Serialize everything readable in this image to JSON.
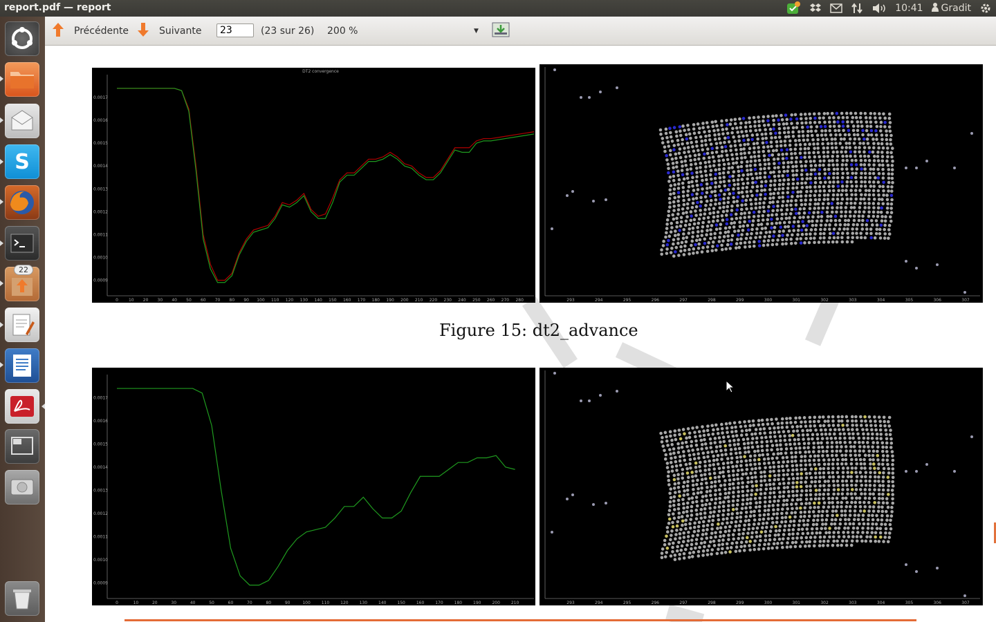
{
  "window": {
    "title": "report.pdf — report"
  },
  "panel": {
    "clock": "10:41",
    "user": "Gradit"
  },
  "toolbar": {
    "prev_label": "Précédente",
    "next_label": "Suivante",
    "page_value": "23",
    "page_count": "(23 sur 26)",
    "zoom": "200 %"
  },
  "launcher": {
    "badge_count": "22"
  },
  "document": {
    "caption": "Figure 15: dt2_advance",
    "plot_title": "DT2 convergence"
  },
  "chart_data": [
    {
      "type": "line",
      "title": "DT2 convergence",
      "x_ticks": [
        "0",
        "10",
        "20",
        "30",
        "40",
        "50",
        "60",
        "70",
        "80",
        "90",
        "100",
        "110",
        "120",
        "130",
        "140",
        "150",
        "160",
        "170",
        "180",
        "190",
        "200",
        "210",
        "220",
        "230",
        "240",
        "250",
        "260",
        "270",
        "280"
      ],
      "y_ticks": [
        "0.0009",
        "0.0010",
        "0.0011",
        "0.0012",
        "0.0013",
        "0.0014",
        "0.0015",
        "0.0016",
        "0.0017"
      ],
      "ylim": [
        0.00085,
        0.0018
      ],
      "series": [
        {
          "color": "#b00000",
          "x": [
            0,
            20,
            40,
            45,
            50,
            55,
            60,
            65,
            70,
            75,
            80,
            85,
            90,
            95,
            100,
            105,
            110,
            115,
            120,
            125,
            130,
            135,
            140,
            145,
            150,
            155,
            160,
            165,
            170,
            175,
            180,
            185,
            190,
            195,
            200,
            205,
            210,
            215,
            220,
            225,
            230,
            235,
            240,
            245,
            250,
            255,
            260,
            270,
            280,
            290
          ],
          "values": [
            0.00174,
            0.00174,
            0.00174,
            0.00173,
            0.00165,
            0.0014,
            0.0011,
            0.00097,
            0.0009,
            0.0009,
            0.00093,
            0.00102,
            0.00108,
            0.00112,
            0.00113,
            0.00114,
            0.00118,
            0.00124,
            0.00123,
            0.00125,
            0.00128,
            0.00121,
            0.00118,
            0.00119,
            0.00126,
            0.00134,
            0.00137,
            0.00137,
            0.0014,
            0.00143,
            0.00143,
            0.00144,
            0.00146,
            0.00144,
            0.00141,
            0.0014,
            0.00137,
            0.00135,
            0.00135,
            0.00138,
            0.00143,
            0.00148,
            0.00148,
            0.00148,
            0.00151,
            0.00152,
            0.00152,
            0.00153,
            0.00154,
            0.00155
          ]
        },
        {
          "color": "#1f9b1f",
          "x": [
            0,
            20,
            40,
            45,
            50,
            55,
            60,
            65,
            70,
            75,
            80,
            85,
            90,
            95,
            100,
            105,
            110,
            115,
            120,
            125,
            130,
            135,
            140,
            145,
            150,
            155,
            160,
            165,
            170,
            175,
            180,
            185,
            190,
            195,
            200,
            205,
            210,
            215,
            220,
            225,
            230,
            235,
            240,
            245,
            250,
            255,
            260,
            270,
            280,
            290
          ],
          "values": [
            0.00174,
            0.00174,
            0.00174,
            0.00173,
            0.00164,
            0.00138,
            0.00108,
            0.00095,
            0.00089,
            0.00089,
            0.00092,
            0.00101,
            0.00107,
            0.00111,
            0.00112,
            0.00113,
            0.00117,
            0.00123,
            0.00122,
            0.00124,
            0.00127,
            0.0012,
            0.00117,
            0.00117,
            0.00124,
            0.00133,
            0.00136,
            0.00136,
            0.00139,
            0.00142,
            0.00142,
            0.00143,
            0.00145,
            0.00143,
            0.0014,
            0.00139,
            0.00136,
            0.00134,
            0.00134,
            0.00137,
            0.00142,
            0.00147,
            0.00146,
            0.00146,
            0.0015,
            0.00151,
            0.00151,
            0.00152,
            0.00153,
            0.00154
          ]
        }
      ]
    },
    {
      "type": "scatter",
      "x_ticks": [
        "293",
        "294",
        "295",
        "296",
        "297",
        "298",
        "299",
        "300",
        "301",
        "302",
        "303",
        "304",
        "305",
        "306",
        "307"
      ]
    },
    {
      "type": "line",
      "x_ticks": [
        "0",
        "10",
        "20",
        "30",
        "40",
        "50",
        "60",
        "70",
        "80",
        "90",
        "100",
        "110",
        "120",
        "130",
        "140",
        "150",
        "160",
        "170",
        "180",
        "190",
        "200",
        "210"
      ],
      "y_ticks": [
        "0.0009",
        "0.0010",
        "0.0011",
        "0.0012",
        "0.0013",
        "0.0014",
        "0.0015",
        "0.0016",
        "0.0017"
      ],
      "ylim": [
        0.00085,
        0.0018
      ],
      "series": [
        {
          "color": "#1f9b1f",
          "x": [
            0,
            20,
            40,
            45,
            50,
            55,
            60,
            65,
            70,
            75,
            80,
            85,
            90,
            95,
            100,
            105,
            110,
            115,
            120,
            125,
            130,
            135,
            140,
            145,
            150,
            155,
            160,
            165,
            170,
            175,
            180,
            185,
            190,
            195,
            200,
            205,
            210
          ],
          "values": [
            0.00174,
            0.00174,
            0.00174,
            0.00172,
            0.00158,
            0.0013,
            0.00105,
            0.00093,
            0.00089,
            0.00089,
            0.00091,
            0.00097,
            0.00104,
            0.00109,
            0.00112,
            0.00113,
            0.00114,
            0.00118,
            0.00123,
            0.00123,
            0.00127,
            0.00122,
            0.00118,
            0.00118,
            0.00121,
            0.00129,
            0.00136,
            0.00136,
            0.00136,
            0.00139,
            0.00142,
            0.00142,
            0.00144,
            0.00144,
            0.00145,
            0.0014,
            0.00139
          ]
        }
      ]
    },
    {
      "type": "scatter",
      "x_ticks": [
        "293",
        "294",
        "295",
        "296",
        "297",
        "298",
        "299",
        "300",
        "301",
        "302",
        "303",
        "304",
        "305",
        "306",
        "307"
      ]
    }
  ]
}
